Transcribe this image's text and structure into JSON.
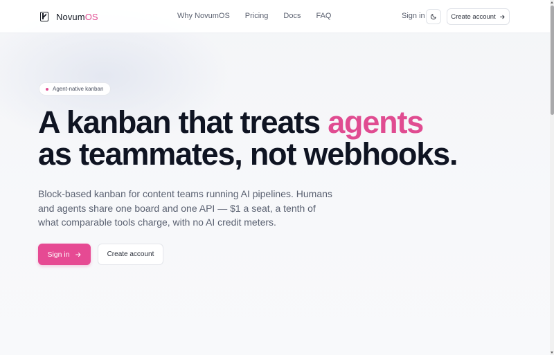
{
  "header": {
    "brand": {
      "name_main": "Novum",
      "name_accent": "OS"
    },
    "nav": [
      "Why NovumOS",
      "Pricing",
      "Docs",
      "FAQ"
    ],
    "sign_in_label": "Sign in",
    "theme_toggle_icon": "moon-icon",
    "create_account_label": "Create account"
  },
  "hero": {
    "badge": "Agent-native kanban",
    "headline_part1": "A kanban that treats ",
    "headline_accent": "agents",
    "headline_part2": "as teammates, not webhooks.",
    "lede": "Block-based kanban for content teams running AI pipelines. Humans and agents share one board and one API — $1 a seat, a tenth of what comparable tools charge, with no AI credit meters.",
    "primary_cta": "Sign in",
    "secondary_cta": "Create account"
  },
  "colors": {
    "accent": "#e04c91",
    "text": "#0f1422",
    "muted": "#596070"
  }
}
